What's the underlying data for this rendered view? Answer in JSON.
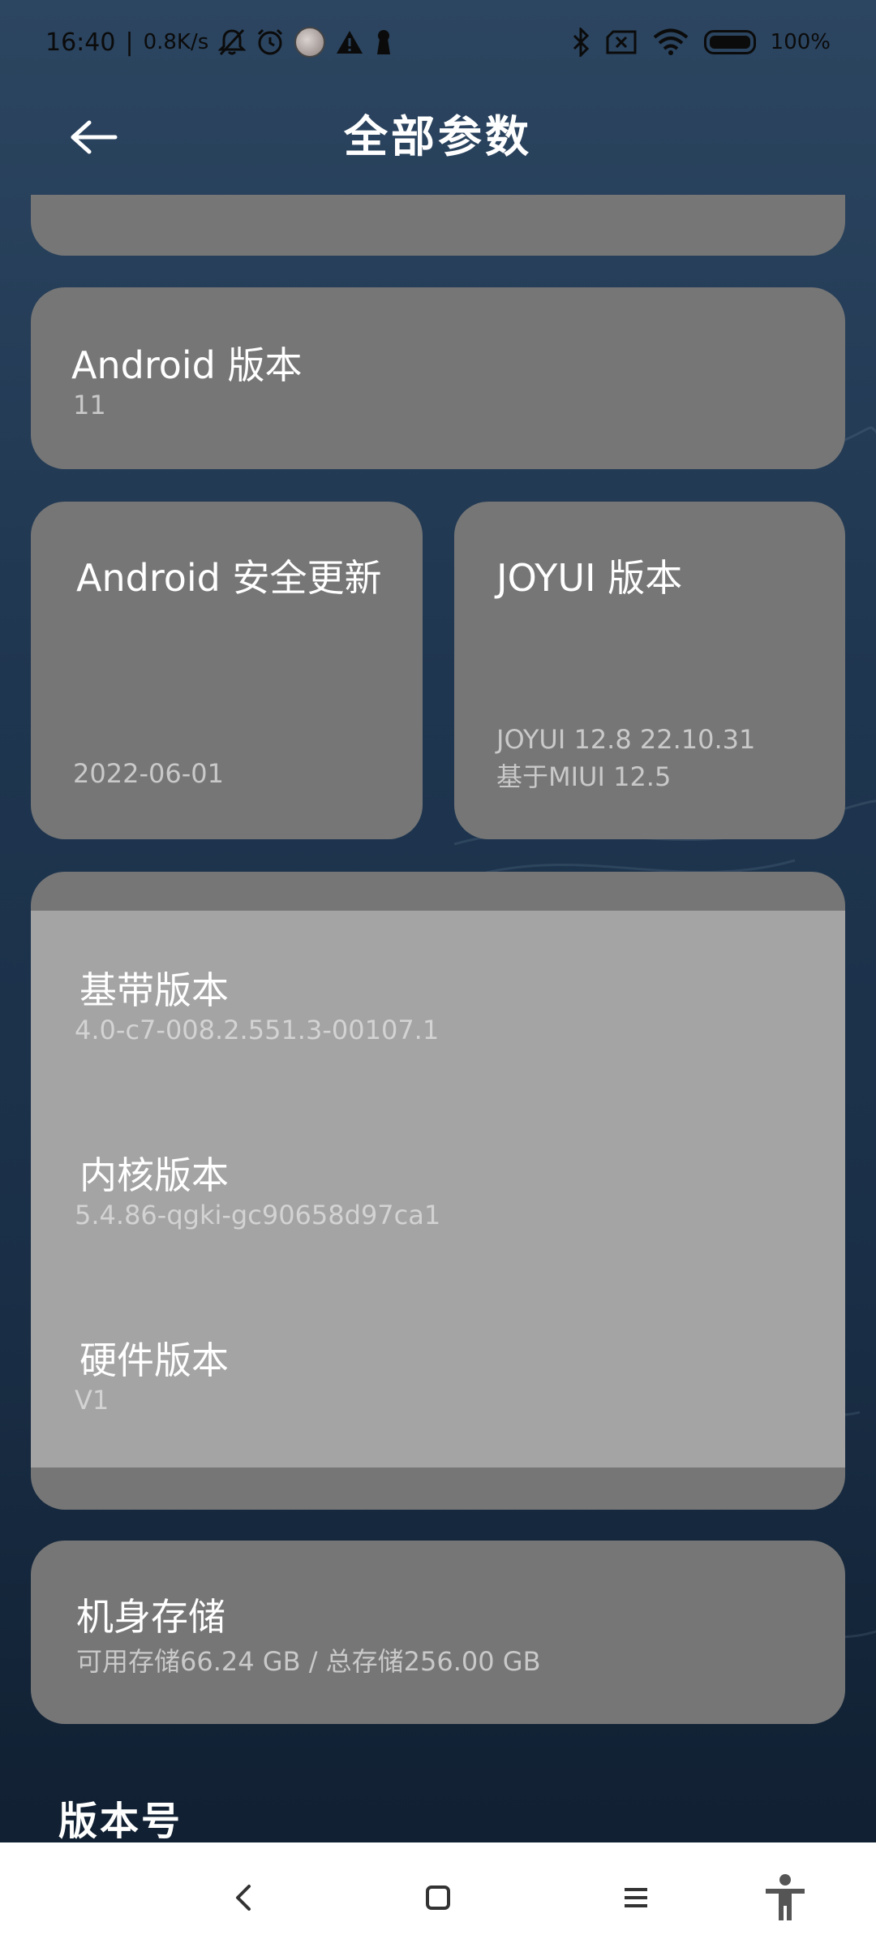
{
  "status_bar": {
    "time": "16:40",
    "separator": "|",
    "net_speed": "0.8K/s",
    "battery": "100%",
    "icons": [
      "bell-off-icon",
      "alarm-icon",
      "avatar",
      "warning-icon",
      "keyhole-icon",
      "bluetooth-icon",
      "sim-off-icon",
      "wifi-icon",
      "battery-icon"
    ]
  },
  "header": {
    "title": "全部参数",
    "back_icon": "arrow-left-icon"
  },
  "cards": {
    "android_version": {
      "label": "Android 版本",
      "value": "11"
    },
    "security_patch": {
      "label": "Android 安全更新",
      "value": "2022-06-01"
    },
    "joyui_version": {
      "label": "JOYUI 版本",
      "value_line1": "JOYUI 12.8 22.10.31",
      "value_line2": "基于MIUI 12.5"
    },
    "baseband": {
      "label": "基带版本",
      "value": "4.0-c7-008.2.551.3-00107.1"
    },
    "kernel": {
      "label": "内核版本",
      "value": "5.4.86-qgki-gc90658d97ca1"
    },
    "hardware": {
      "label": "硬件版本",
      "value": "V1"
    },
    "storage": {
      "label": "机身存储",
      "value": "可用存储66.24 GB / 总存储256.00 GB"
    }
  },
  "section": {
    "build_number_title": "版本号"
  },
  "nav_bar": {
    "icons": [
      "back-nav-icon",
      "home-nav-icon",
      "recents-nav-icon",
      "accessibility-icon"
    ]
  }
}
